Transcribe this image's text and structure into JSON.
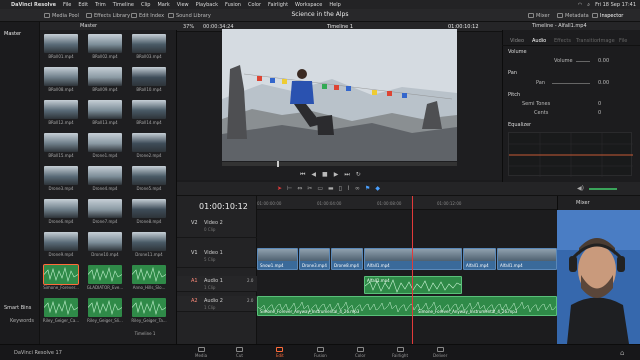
{
  "menubar": {
    "app": "DaVinci Resolve",
    "items": [
      "File",
      "Edit",
      "Trim",
      "Timeline",
      "Clip",
      "Mark",
      "View",
      "Playback",
      "Fusion",
      "Color",
      "Fairlight",
      "Workspace",
      "Help"
    ],
    "clock": "Fri 18 Sep 17:41"
  },
  "toolbar": {
    "media_pool": "Media Pool",
    "effects": "Effects Library",
    "edit_index": "Edit Index",
    "sound_library": "Sound Library",
    "project_title": "Science in the Alps",
    "mixer": "Mixer",
    "metadata": "Metadata",
    "inspector": "Inspector"
  },
  "mediapool": {
    "header": "Master",
    "bins": [
      "Master"
    ],
    "smart_bins": "Smart Bins",
    "keywords": "Keywords",
    "clips": [
      "BRoll01.mp4",
      "BRoll02.mp4",
      "BRoll03.mp4",
      "BRoll08.mp4",
      "BRoll09.mp4",
      "BRoll10.mp4",
      "BRoll12.mp4",
      "BRoll13.mp4",
      "BRoll14.mp4",
      "BRoll15.mp4",
      "Drone1.mp4",
      "Drone2.mp4",
      "Drone3.mp4",
      "Drone4.mp4",
      "Drone5.mp4",
      "Drone6.mp4",
      "Drone7.mp4",
      "Drone8.mp4",
      "Drone9.mp4",
      "Drone10.mp4",
      "Drone11.mp4",
      "Simone_Forever...",
      "GLADIATOR_Eve...",
      "Anno_Hills_Slo...",
      "Riley_Geiger_Ca...",
      "Riley_Geiger_Sli...",
      "Riley_Geiger_Ta..."
    ],
    "timeline_item": "Timeline 1"
  },
  "viewer": {
    "zoom": "37%",
    "source_tc": "00:00:34:24",
    "timeline_name": "Timeline 1",
    "record_tc": "01:00:10:12"
  },
  "inspector": {
    "clip_name": "Timeline - Alfall1.mp4",
    "tabs": [
      "Video",
      "Audio",
      "Effects",
      "Transition",
      "Image",
      "File"
    ],
    "active_tab": "Audio",
    "sections": {
      "volume": "Volume",
      "volume_label": "Volume",
      "volume_value": "0.00",
      "pan": "Pan",
      "pan_label": "Pan",
      "pan_value": "0.00",
      "pitch": "Pitch",
      "semitones_label": "Semi Tones",
      "semitones_value": "0",
      "cents_label": "Cents",
      "cents_value": "0",
      "equalizer": "Equalizer"
    }
  },
  "timeline": {
    "timecode": "01:00:10:12",
    "ruler": [
      "01:00:00:00",
      "01:00:04:00",
      "01:00:08:00",
      "01:00:12:00"
    ],
    "tracks": [
      {
        "id": "V2",
        "name": "Video 2",
        "info": "0 Clip"
      },
      {
        "id": "V1",
        "name": "Video 1",
        "info": "5 Clip"
      },
      {
        "id": "A1",
        "name": "Audio 1",
        "level": "2.0",
        "info": "1 Clip"
      },
      {
        "id": "A2",
        "name": "Audio 2",
        "level": "2.0",
        "info": "1 Clip"
      }
    ],
    "video_clips": [
      "Snow1.mp4",
      "Drone3.mp4",
      "Drone8.mp4",
      "Alfall1.mp4",
      "Alfall1.mp4",
      "Alfall1.mp4"
    ],
    "audio_clips": [
      "Alfall1.mp4",
      "Simone_Forever_Anyway_Instrumental_4_26.mp3",
      "Simone_Forever_Anyway_Instrumental_4_26.mp3"
    ]
  },
  "mixer": {
    "title": "Mixer"
  },
  "bottom": {
    "version": "DaVinci Resolve 17",
    "pages": [
      "Media",
      "Cut",
      "Edit",
      "Fusion",
      "Color",
      "Fairlight",
      "Deliver"
    ],
    "active_page": "Edit"
  },
  "colors": {
    "accent": "#ff6c3a",
    "video_clip": "#3a6a9a",
    "audio_clip": "#3aa45a",
    "playhead": "#e23a3a"
  }
}
